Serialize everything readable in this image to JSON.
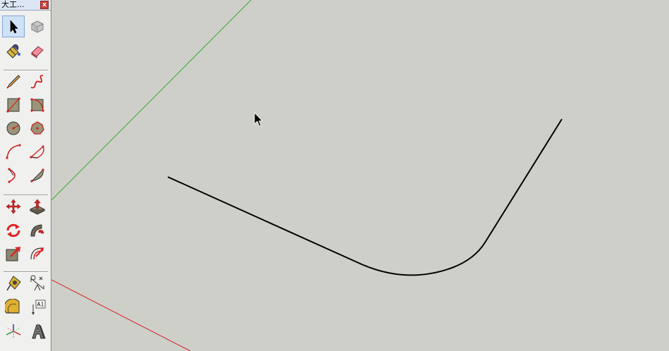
{
  "toolbar": {
    "title": "大工...",
    "close_label": "x",
    "tools": [
      {
        "name": "select",
        "active": true
      },
      {
        "name": "component"
      },
      {
        "name": "paint-bucket"
      },
      {
        "name": "eraser"
      },
      {
        "name": "pencil"
      },
      {
        "name": "freehand"
      },
      {
        "name": "rectangle"
      },
      {
        "name": "rotated-rectangle"
      },
      {
        "name": "circle"
      },
      {
        "name": "polygon"
      },
      {
        "name": "arc"
      },
      {
        "name": "pie"
      },
      {
        "name": "two-point-arc"
      },
      {
        "name": "three-point-arc"
      },
      {
        "name": "move"
      },
      {
        "name": "push-pull"
      },
      {
        "name": "rotate"
      },
      {
        "name": "follow-me"
      },
      {
        "name": "scale"
      },
      {
        "name": "offset"
      },
      {
        "name": "tape-measure"
      },
      {
        "name": "dimension"
      },
      {
        "name": "protractor"
      },
      {
        "name": "text"
      },
      {
        "name": "axes"
      },
      {
        "name": "3d-text"
      }
    ],
    "text_tool_label": "A1"
  },
  "viewport": {
    "background": "#cfcfca",
    "green_axis_color": "#33aa33",
    "red_axis_color": "#cc2222",
    "curve_color": "#000000"
  }
}
